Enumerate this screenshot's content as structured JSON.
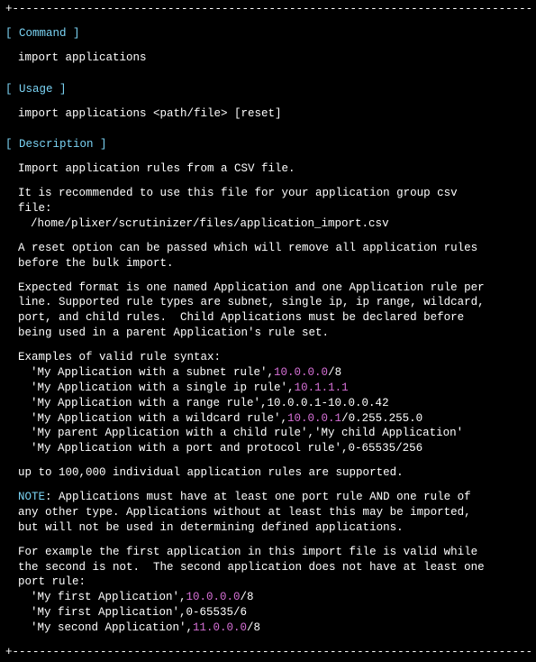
{
  "border": "+-----------------------------------------------------------------------------+",
  "sections": {
    "command": {
      "header": "[ Command ]",
      "content": "import applications"
    },
    "usage": {
      "header": "[ Usage ]",
      "content": "import applications <path/file> [reset]"
    },
    "description": {
      "header": "[ Description ]",
      "intro": "Import application rules from a CSV file.",
      "recommend1": "It is recommended to use this file for your application group csv",
      "recommend2": "file:",
      "filepath": "/home/plixer/scrutinizer/files/application_import.csv",
      "reset1": "A reset option can be passed which will remove all application rules",
      "reset2": "before the bulk import.",
      "format1": "Expected format is one named Application and one Application rule per",
      "format2": "line. Supported rule types are subnet, single ip, ip range, wildcard,",
      "format3": "port, and child rules.  Child Applications must be declared before",
      "format4": "being used in a parent Application's rule set.",
      "examples_header": "Examples of valid rule syntax:",
      "ex1_pre": "'My Application with a subnet rule',",
      "ex1_ip": "10.0.0.0",
      "ex1_post": "/8",
      "ex2_pre": "'My Application with a single ip rule',",
      "ex2_ip": "10.1.1.1",
      "ex2_post": "",
      "ex3_pre": "'My Application with a range rule',10.0.0.1-10.0.0.42",
      "ex4_pre": "'My Application with a wildcard rule',",
      "ex4_ip": "10.0.0.1",
      "ex4_post": "/0.255.255.0",
      "ex5": "'My parent Application with a child rule','My child Application'",
      "ex6": "'My Application with a port and protocol rule',0-65535/256",
      "limit": "up to 100,000 individual application rules are supported.",
      "note_label": "NOTE",
      "note1": ": Applications must have at least one port rule AND one rule of",
      "note2": "any other type. Applications without at least this may be imported,",
      "note3": "but will not be used in determining defined applications.",
      "forex1": "For example the first application in this import file is valid while",
      "forex2": "the second is not.  The second application does not have at least one",
      "forex3": "port rule:",
      "fe1_pre": "'My first Application',",
      "fe1_ip": "10.0.0.0",
      "fe1_post": "/8",
      "fe2": "'My first Application',0-65535/6",
      "fe3_pre": "'My second Application',",
      "fe3_ip": "11.0.0.0",
      "fe3_post": "/8"
    }
  }
}
